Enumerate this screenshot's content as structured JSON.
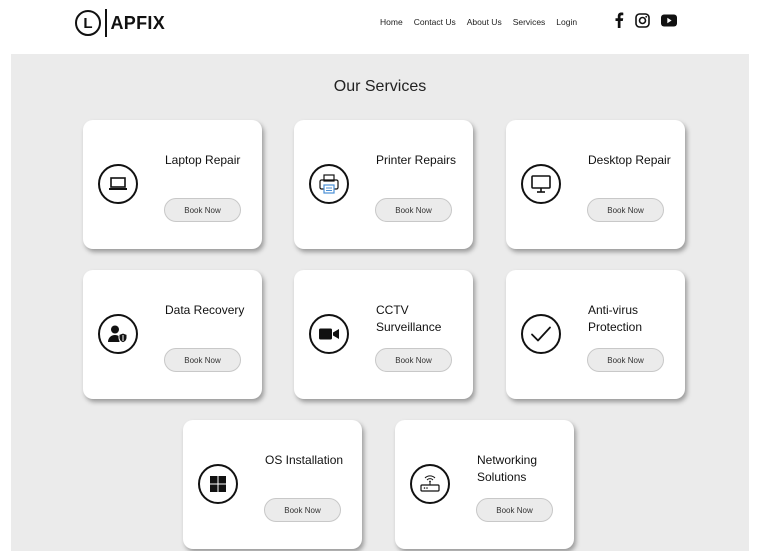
{
  "brand": {
    "logo_letter": "L",
    "name": "APFIX"
  },
  "nav": {
    "items": [
      {
        "label": "Home"
      },
      {
        "label": "Contact Us"
      },
      {
        "label": "About Us"
      },
      {
        "label": "Services"
      },
      {
        "label": "Login"
      }
    ]
  },
  "social": {
    "icons": [
      "facebook-icon",
      "instagram-icon",
      "youtube-icon"
    ]
  },
  "services": {
    "title": "Our Services",
    "cards": [
      {
        "title": "Laptop Repair",
        "button": "Book Now",
        "icon": "laptop-icon"
      },
      {
        "title": "Printer Repairs",
        "button": "Book Now",
        "icon": "printer-icon"
      },
      {
        "title": "Desktop Repair",
        "button": "Book Now",
        "icon": "desktop-icon"
      },
      {
        "title": "Data Recovery",
        "button": "Book Now",
        "icon": "user-shield-icon"
      },
      {
        "title": "CCTV Surveillance",
        "button": "Book Now",
        "icon": "video-camera-icon"
      },
      {
        "title": "Anti-virus Protection",
        "button": "Book Now",
        "icon": "checkmark-icon"
      },
      {
        "title": "OS Installation",
        "button": "Book Now",
        "icon": "windows-icon"
      },
      {
        "title": "Networking Solutions",
        "button": "Book Now",
        "icon": "router-icon"
      }
    ]
  },
  "colors": {
    "page_bg": "#ebebeb",
    "card_bg": "#ffffff",
    "button_bg": "#ebebeb",
    "text": "#111111"
  }
}
